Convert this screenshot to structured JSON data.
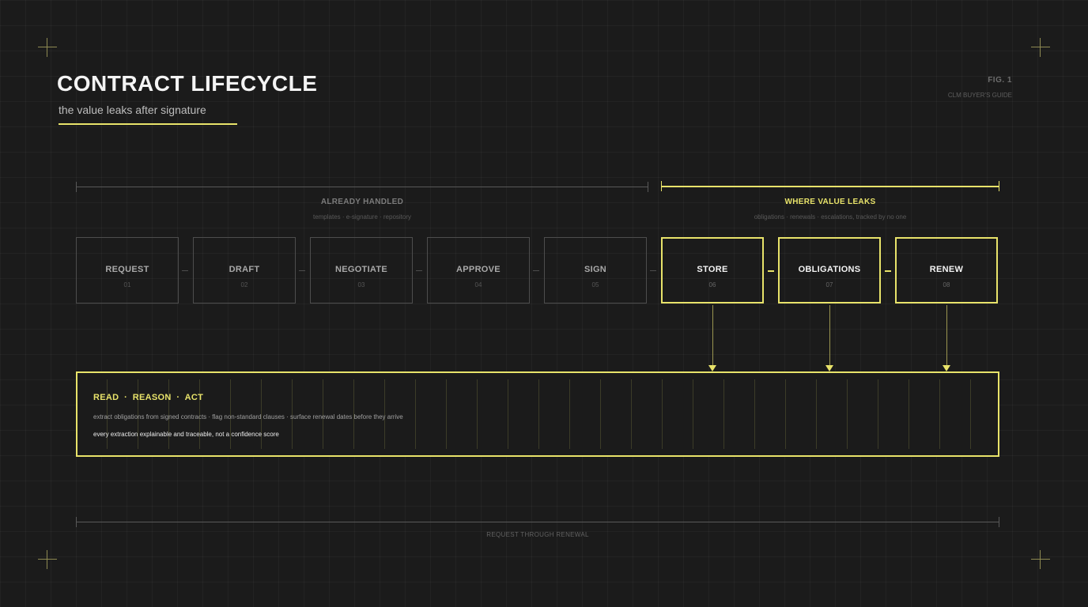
{
  "header": {
    "title": "CONTRACT LIFECYCLE",
    "subtitle": "the value leaks after signature",
    "fig_label": "FIG. 1",
    "guide_label": "CLM BUYER'S GUIDE"
  },
  "groups": {
    "handled": {
      "label": "ALREADY HANDLED",
      "sub": "templates · e-signature · repository"
    },
    "leak": {
      "label": "WHERE VALUE LEAKS",
      "sub": "obligations · renewals · escalations, tracked by no one"
    }
  },
  "stages": [
    {
      "name": "REQUEST",
      "num": "01"
    },
    {
      "name": "DRAFT",
      "num": "02"
    },
    {
      "name": "NEGOTIATE",
      "num": "03"
    },
    {
      "name": "APPROVE",
      "num": "04"
    },
    {
      "name": "SIGN",
      "num": "05"
    },
    {
      "name": "STORE",
      "num": "06"
    },
    {
      "name": "OBLIGATIONS",
      "num": "07"
    },
    {
      "name": "RENEW",
      "num": "08"
    }
  ],
  "engine": {
    "title": "READ  ·  REASON  ·  ACT",
    "desc": "extract obligations from signed contracts · flag non-standard clauses · surface renewal dates before they arrive",
    "note": "every extraction explainable and traceable, not a confidence score"
  },
  "footer": {
    "label": "REQUEST THROUGH RENEWAL"
  },
  "colors": {
    "accent": "#e8e36a",
    "background": "#1b1b1b",
    "muted": "#4d4d4d"
  }
}
